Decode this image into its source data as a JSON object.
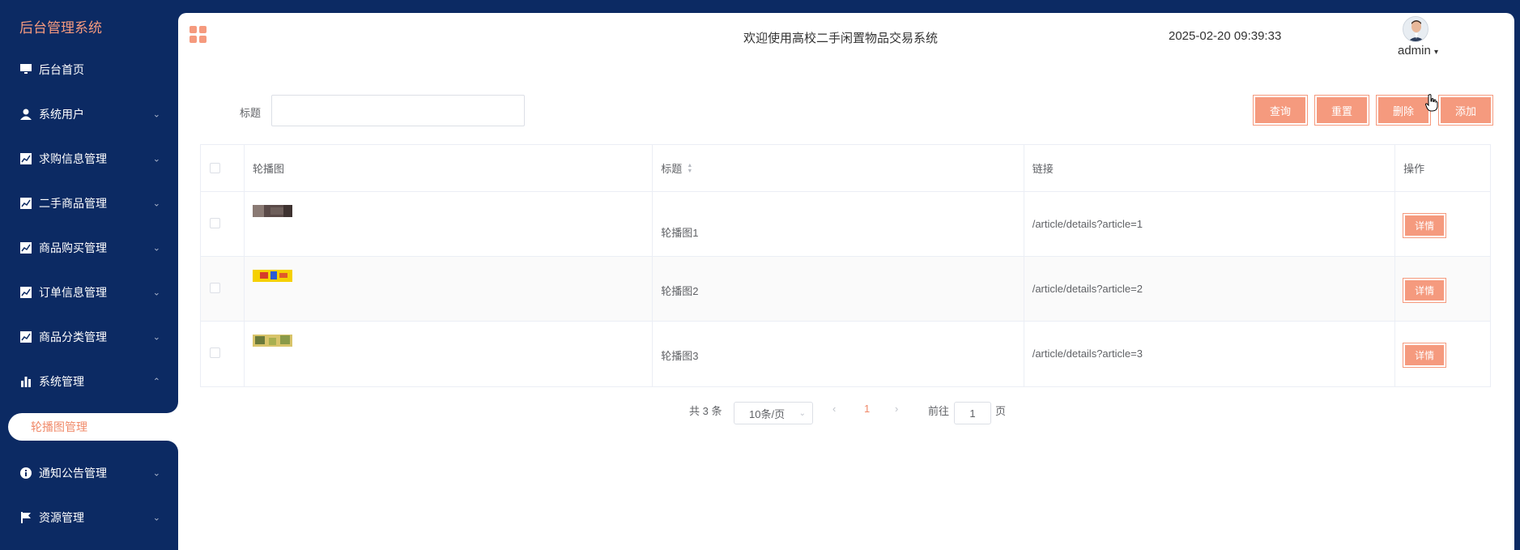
{
  "sidebar": {
    "brand": "后台管理系统",
    "items": [
      {
        "label": "后台首页",
        "icon": "monitor-icon"
      },
      {
        "label": "系统用户",
        "icon": "user-icon"
      },
      {
        "label": "求购信息管理",
        "icon": "chart-icon"
      },
      {
        "label": "二手商品管理",
        "icon": "chart-icon"
      },
      {
        "label": "商品购买管理",
        "icon": "chart-icon"
      },
      {
        "label": "订单信息管理",
        "icon": "chart-icon"
      },
      {
        "label": "商品分类管理",
        "icon": "chart-icon"
      },
      {
        "label": "系统管理",
        "icon": "bar-chart-icon"
      },
      {
        "label": "通知公告管理",
        "icon": "info-icon"
      },
      {
        "label": "资源管理",
        "icon": "flag-icon"
      }
    ],
    "active_sub": "轮播图管理"
  },
  "header": {
    "welcome": "欢迎使用高校二手闲置物品交易系统",
    "datetime": "2025-02-20 09:39:33",
    "user": "admin"
  },
  "search": {
    "label": "标题",
    "value": "",
    "buttons": {
      "query": "查询",
      "reset": "重置",
      "delete": "删除",
      "add": "添加"
    }
  },
  "table": {
    "columns": [
      "轮播图",
      "标题",
      "链接",
      "操作"
    ],
    "rows": [
      {
        "title": "轮播图1",
        "link": "/article/details?article=1",
        "action": "详情"
      },
      {
        "title": "轮播图2",
        "link": "/article/details?article=2",
        "action": "详情"
      },
      {
        "title": "轮播图3",
        "link": "/article/details?article=3",
        "action": "详情"
      }
    ]
  },
  "pagination": {
    "total": "共 3 条",
    "page_size": "10条/页",
    "current": "1",
    "goto_prefix": "前往",
    "goto_value": "1",
    "goto_suffix": "页"
  },
  "colors": {
    "sidebar_bg": "#0c2a63",
    "accent": "#f59a7e",
    "white": "#ffffff"
  }
}
